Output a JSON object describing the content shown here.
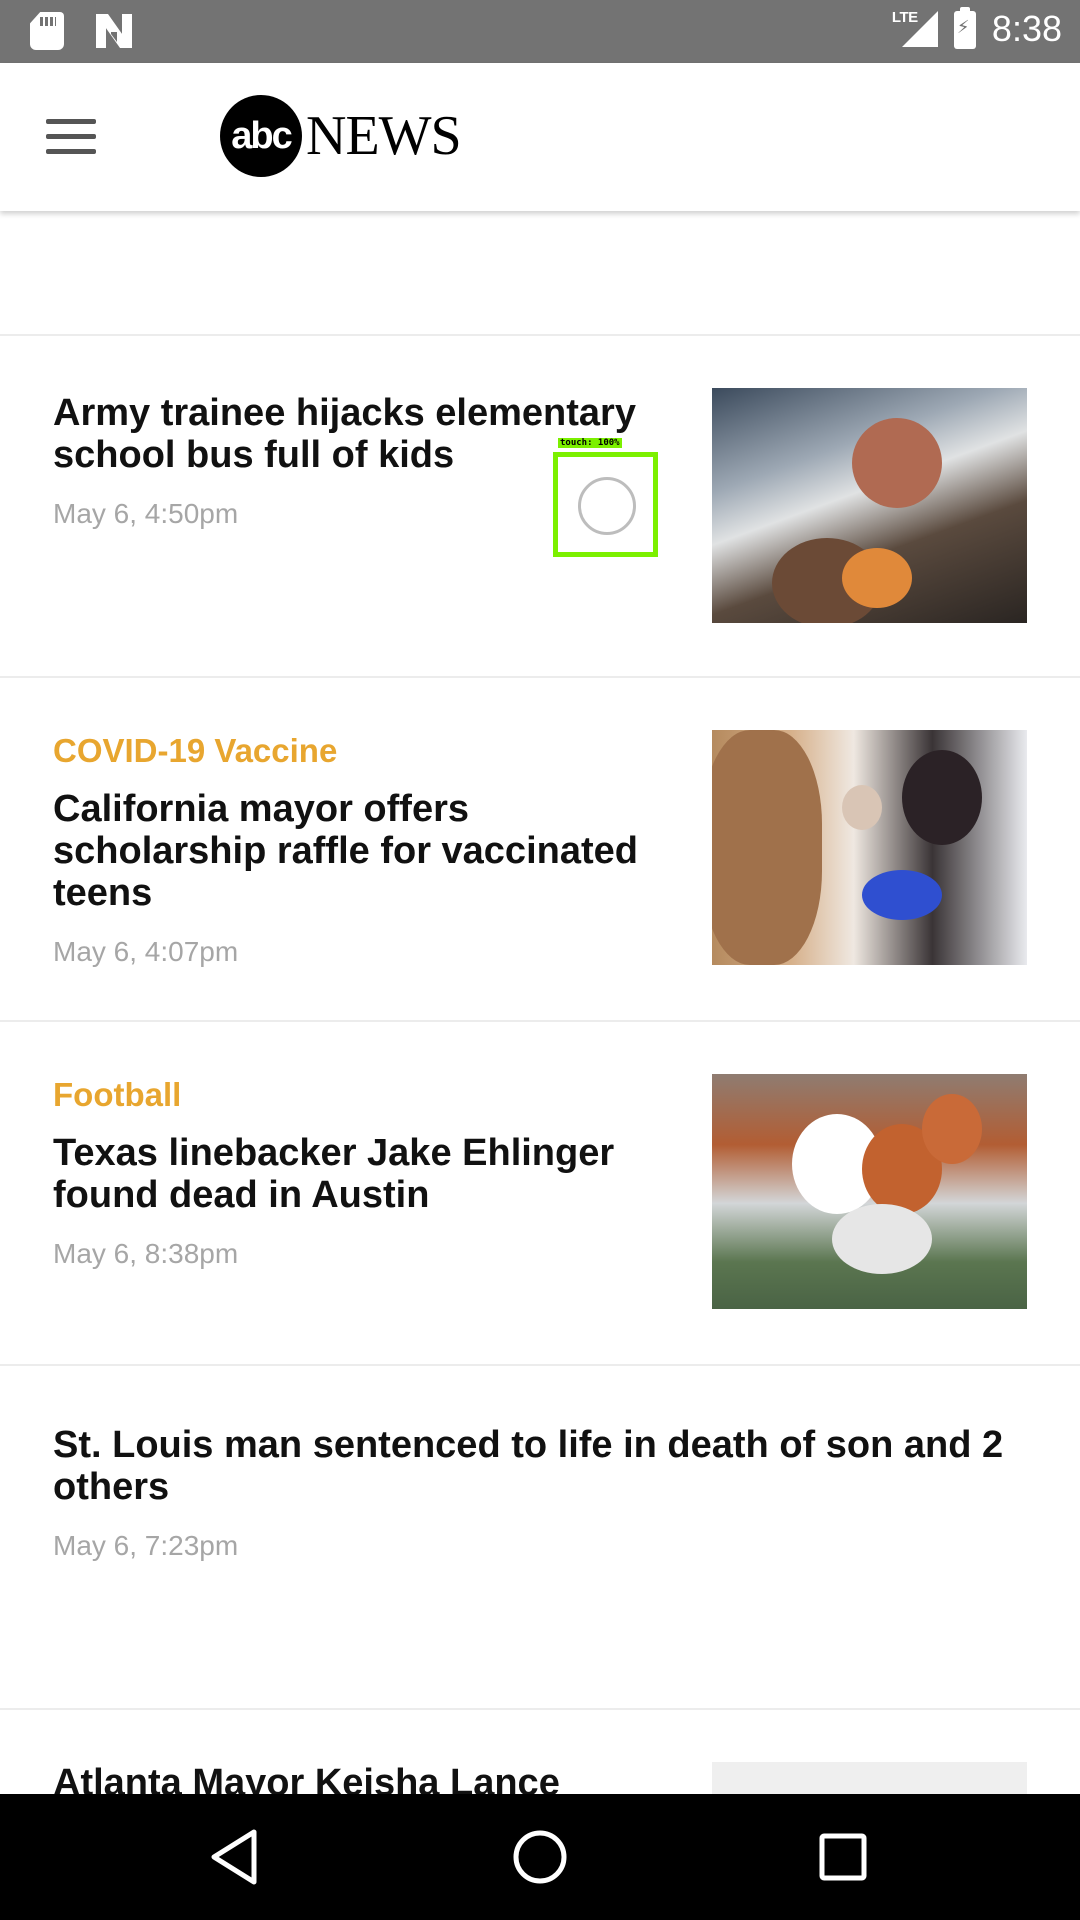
{
  "status_bar": {
    "time": "8:38",
    "network": "LTE",
    "icons": [
      "sd-card-icon",
      "n-notification-icon",
      "lte-signal-icon",
      "battery-charging-icon"
    ]
  },
  "header": {
    "menu_icon": "hamburger-menu-icon",
    "logo_abc": "abc",
    "logo_news": "NEWS"
  },
  "stories": [
    {
      "category": "",
      "headline": "Army trainee hijacks elementary school bus full of kids",
      "timestamp": "May 6, 4:50pm",
      "has_thumbnail": true
    },
    {
      "category": "COVID-19 Vaccine",
      "headline": "California mayor offers scholarship raffle for vaccinated teens",
      "timestamp": "May 6, 4:07pm",
      "has_thumbnail": true
    },
    {
      "category": "Football",
      "headline": "Texas linebacker Jake Ehlinger found dead in Austin",
      "timestamp": "May 6, 8:38pm",
      "has_thumbnail": true
    },
    {
      "category": "",
      "headline": "St. Louis man sentenced to life in death of son and 2 others",
      "timestamp": "May 6, 7:23pm",
      "has_thumbnail": false
    },
    {
      "category": "",
      "headline": "Atlanta Mayor Keisha Lance",
      "timestamp": "",
      "has_thumbnail": true
    }
  ],
  "touch_indicator": {
    "label": "touch: 100%"
  },
  "nav_bar": {
    "icons": [
      "back-icon",
      "home-icon",
      "recent-apps-icon"
    ]
  },
  "colors": {
    "accent_category": "#e8a62f",
    "status_bar": "#737373",
    "timestamp": "#a6a6a6",
    "touch_box": "#7cf000"
  }
}
